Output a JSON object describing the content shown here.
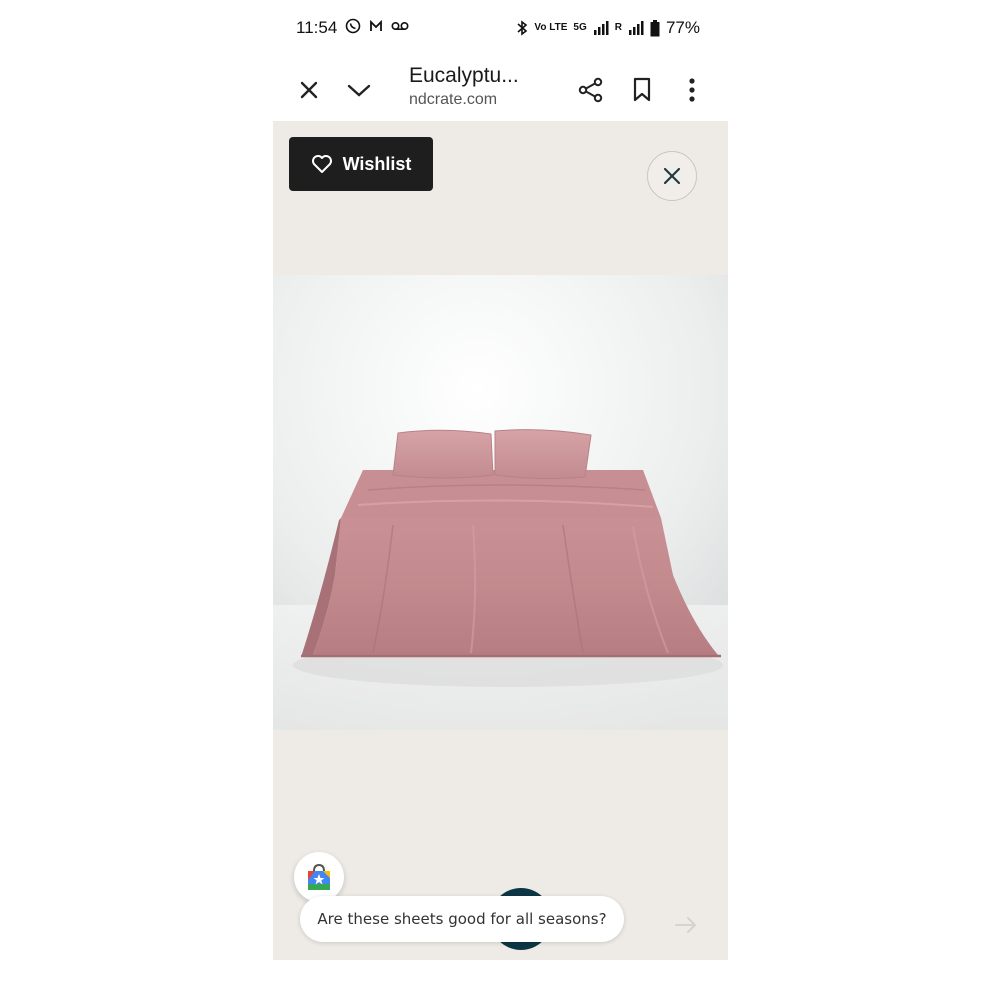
{
  "status_bar": {
    "time": "11:54",
    "left_icons": [
      "whatsapp-icon",
      "gmail-icon",
      "voicemail-icon"
    ],
    "volte": "Vo LTE",
    "net": "5G",
    "roaming": "R",
    "battery": "77%"
  },
  "toolbar": {
    "title": "Eucalyptu...",
    "url": "ndcrate.com"
  },
  "content": {
    "wishlist_label": "Wishlist",
    "suggestion": "Are these sheets good for all seasons?"
  },
  "colors": {
    "sheet": "#c48d8f",
    "background": "#eeebe6",
    "wishlist_bg": "#1e1e1e",
    "fab": "#0d3644"
  }
}
